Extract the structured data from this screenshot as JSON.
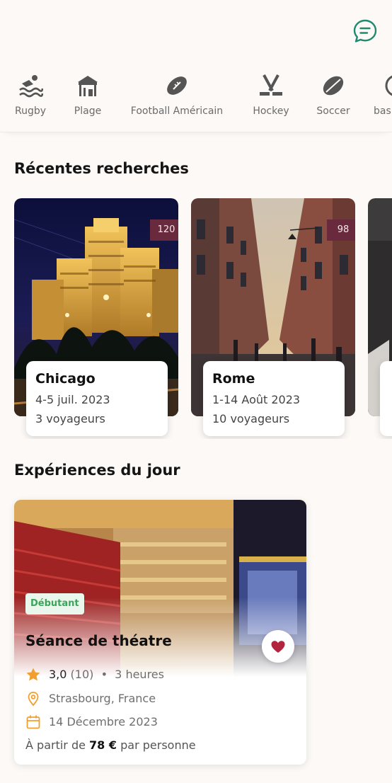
{
  "colors": {
    "background": "#fcf9f6",
    "accent_teal": "#1f8a6e",
    "count_badge": "#6a2a3d",
    "heart": "#b3243f",
    "level_badge_text": "#3aa65a",
    "icon_orange": "#f0a030"
  },
  "header": {
    "chat_icon": "chat-bubble-icon"
  },
  "categories": [
    {
      "label": "Rugby",
      "icon": "swimming-icon"
    },
    {
      "label": "Plage",
      "icon": "beach-hut-icon"
    },
    {
      "label": "Football Américain",
      "icon": "american-football-icon"
    },
    {
      "label": "Hockey",
      "icon": "hockey-sticks-icon"
    },
    {
      "label": "Soccer",
      "icon": "rugby-ball-icon"
    },
    {
      "label": "bas",
      "icon": "ball-icon"
    }
  ],
  "recent": {
    "title": "Récentes recherches",
    "items": [
      {
        "count": "120",
        "city": "Chicago",
        "dates": "4-5 juil. 2023",
        "travelers": "3 voyageurs"
      },
      {
        "count": "98",
        "city": "Rome",
        "dates": "1-14 Août 2023",
        "travelers": "10 voyageurs"
      },
      {
        "count": "",
        "city": "",
        "dates": "",
        "travelers": ""
      }
    ]
  },
  "experiences": {
    "title": "Expériences du jour",
    "card": {
      "level": "Débutant",
      "name": "Séance de théatre",
      "rating": "3,0",
      "reviews": "(10)",
      "separator": "•",
      "duration": "3 heures",
      "location": "Strasbourg, France",
      "date": "14 Décembre 2023",
      "price_prefix": "À partir de",
      "price": "78 €",
      "price_suffix": "par personne",
      "favorited": true
    }
  }
}
